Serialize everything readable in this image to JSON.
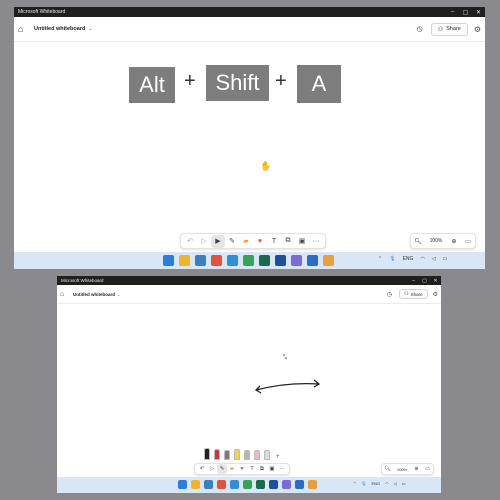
{
  "top_window": {
    "title": "Microsoft Whiteboard",
    "doc_name": "Untitled whiteboard",
    "share_label": "Share",
    "keys": [
      "Alt",
      "Shift",
      "A"
    ],
    "plus": "+",
    "zoom": "100%",
    "tray_lang": "ENG"
  },
  "bottom_window": {
    "title": "Microsoft Whiteboard",
    "doc_name": "Untitled whiteboard",
    "share_label": "Share",
    "zoom": "100%",
    "tray_lang": "ENG"
  },
  "colors": {
    "desktop": "#8a8a8e",
    "titlebar": "#1f1f1f",
    "key_bg": "#7d7d7d",
    "taskbar": "#d9e6f5"
  },
  "pens": [
    {
      "name": "black-pen",
      "color": "#222222"
    },
    {
      "name": "red-pen",
      "color": "#d13438"
    },
    {
      "name": "gray-pen",
      "color": "#7a7a7a"
    },
    {
      "name": "yellow-highlighter",
      "color": "#f2d44a"
    },
    {
      "name": "light-gray-pen",
      "color": "#b5b5b5"
    },
    {
      "name": "pink-pen",
      "color": "#f0b8c4"
    },
    {
      "name": "white-pen",
      "color": "#dcdcdc"
    }
  ]
}
